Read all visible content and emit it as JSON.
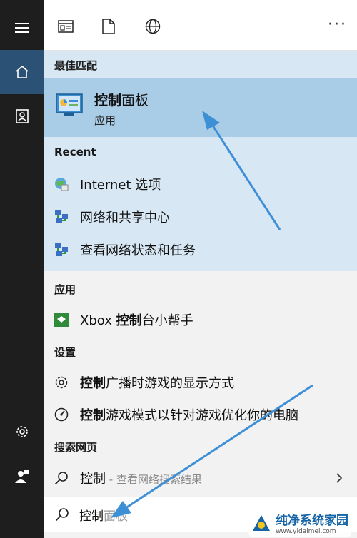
{
  "toolbar": {
    "more_label": "···"
  },
  "best_match": {
    "heading": "最佳匹配",
    "title_bold": "控制",
    "title_rest": "面板",
    "subtitle": "应用"
  },
  "recent": {
    "heading": "Recent",
    "items": [
      {
        "label": "Internet 选项",
        "icon": "internet-options-icon"
      },
      {
        "label": "网络和共享中心",
        "icon": "network-icon"
      },
      {
        "label": "查看网络状态和任务",
        "icon": "network-icon"
      }
    ]
  },
  "apps": {
    "heading": "应用",
    "items": [
      {
        "pre": "Xbox ",
        "bold": "控制",
        "rest": "台小帮手"
      }
    ]
  },
  "settings": {
    "heading": "设置",
    "items": [
      {
        "bold": "控制",
        "rest": "广播时游戏的显示方式",
        "icon": "gear-icon"
      },
      {
        "bold": "控制",
        "rest": "游戏模式以针对游戏优化你的电脑",
        "icon": "game-mode-icon"
      }
    ]
  },
  "web": {
    "heading": "搜索网页",
    "item": {
      "label": "控制",
      "suffix": " - 查看网络搜索结果"
    }
  },
  "search": {
    "typed": "控制",
    "ghost": "面板"
  },
  "watermark": {
    "title": "纯净系统家园",
    "url": "www.yidaimei.com"
  },
  "colors": {
    "accent": "#2b5275",
    "best_match_bg": "#a9cde7",
    "section_bg": "#d8e7f4",
    "arrow": "#3d8fd6"
  }
}
